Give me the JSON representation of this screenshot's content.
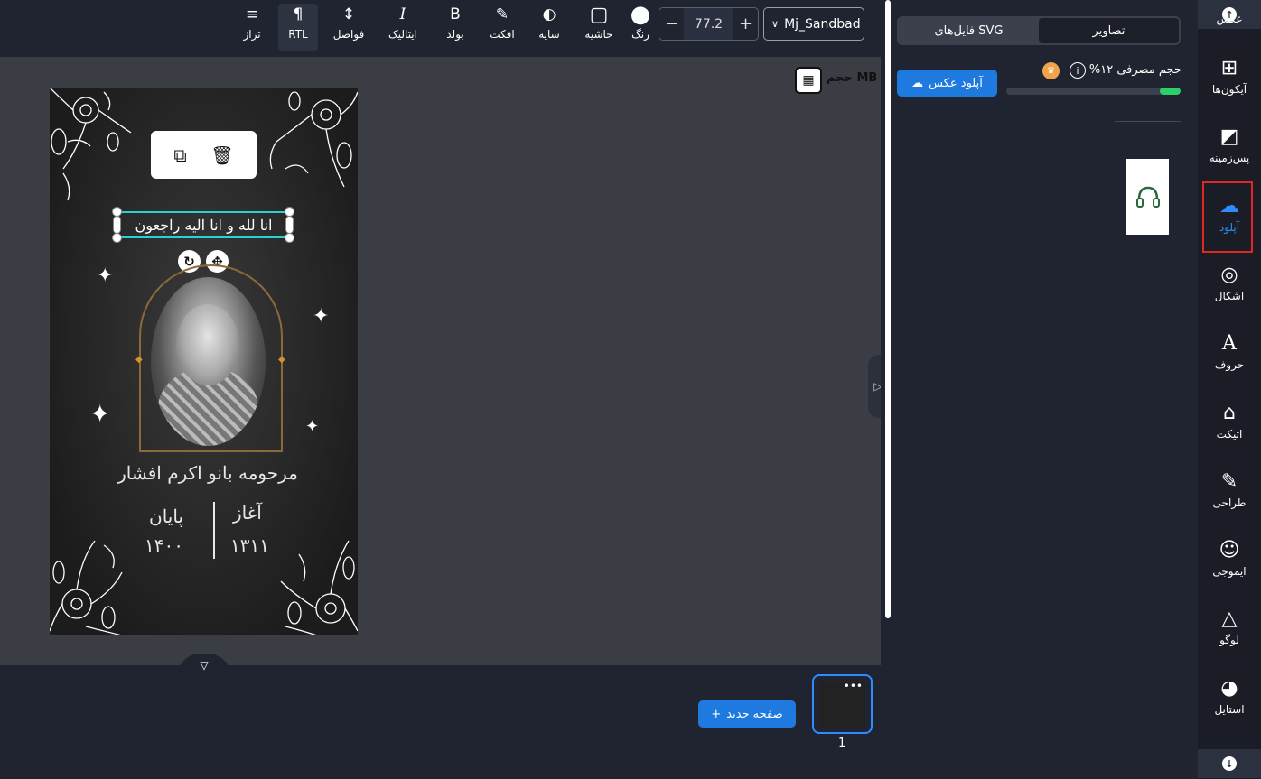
{
  "toolbar": {
    "tools": [
      {
        "id": "align",
        "label": "تراز",
        "icon": "≡"
      },
      {
        "id": "rtl",
        "label": "RTL",
        "icon": "¶"
      },
      {
        "id": "spacing",
        "label": "فواصل",
        "icon": "↕"
      },
      {
        "id": "italic",
        "label": "ایتالیک",
        "icon": "I"
      },
      {
        "id": "bold",
        "label": "بولد",
        "icon": "B"
      },
      {
        "id": "effect",
        "label": "افکت",
        "icon": "✎"
      },
      {
        "id": "shadow",
        "label": "سایه",
        "icon": "◐"
      },
      {
        "id": "border",
        "label": "حاشیه",
        "icon": "▢"
      },
      {
        "id": "color",
        "label": "رنگ",
        "icon": "●"
      }
    ],
    "font_size": "77.2",
    "font_name": "Mj_Sandbad",
    "minus": "−",
    "plus": "+",
    "chevron": "∨"
  },
  "canvas": {
    "size_label": "حجم MB",
    "quote": "انا لله و انا الیه راجعون",
    "name": "مرحومه بانو اکرم افشار",
    "start_label": "آغاز",
    "start_year": "۱۳۱۱",
    "end_label": "پایان",
    "end_year": "۱۴۰۰"
  },
  "pages": {
    "new_page": "صفحه جدید",
    "page_number": "1",
    "dots": "•••"
  },
  "panel": {
    "tabs": [
      "تصاویر",
      "فایل‌های SVG"
    ],
    "active_tab": "تصاویر",
    "usage_label": "حجم مصرفی ۱۲%",
    "usage_percent": 12,
    "upload_button": "آپلود عکس"
  },
  "rail": {
    "items": [
      {
        "label": "عکس",
        "icon": "▲"
      },
      {
        "label": "آیکون‌ها",
        "icon": "⊞"
      },
      {
        "label": "پس‌زمینه",
        "icon": "◩"
      },
      {
        "label": "آپلود",
        "icon": "☁"
      },
      {
        "label": "اشکال",
        "icon": "◎"
      },
      {
        "label": "حروف",
        "icon": "A"
      },
      {
        "label": "اتیکت",
        "icon": "⌂"
      },
      {
        "label": "طراحی",
        "icon": "✎"
      },
      {
        "label": "ایموجی",
        "icon": "☺"
      },
      {
        "label": "لوگو",
        "icon": "△"
      },
      {
        "label": "استایل",
        "icon": "◕"
      }
    ],
    "active": "آپلود"
  },
  "colors": {
    "accent": "#1f7ae0",
    "highlight": "#e42525",
    "progress": "#2bd06a",
    "selection": "#2bd0d0",
    "gold": "#d5912b"
  }
}
